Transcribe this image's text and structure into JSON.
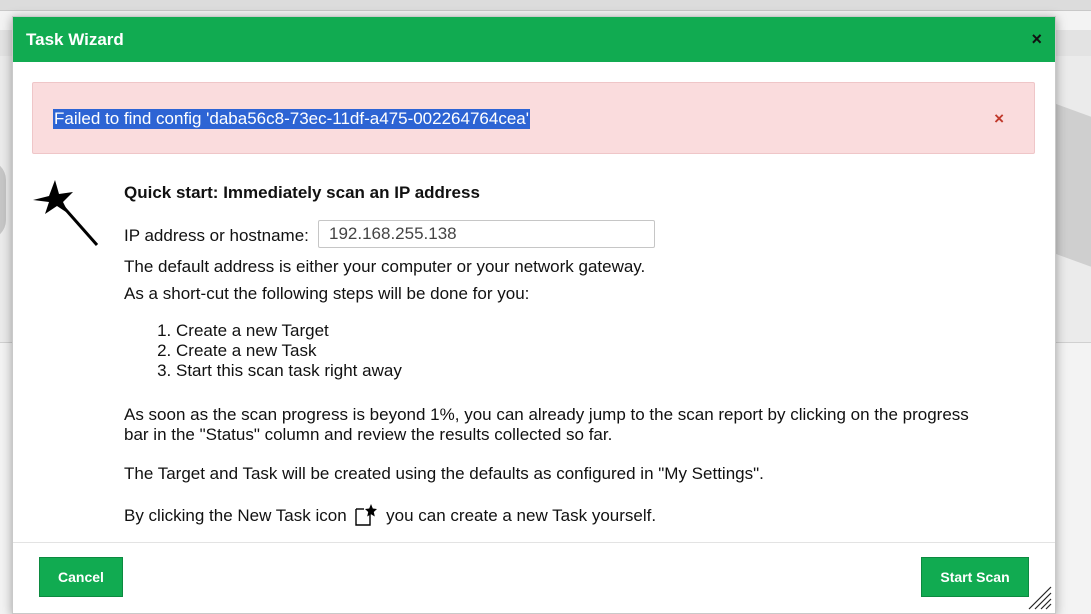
{
  "dialog": {
    "title": "Task Wizard",
    "close_glyph": "×"
  },
  "alert": {
    "message": "Failed to find config 'daba56c8-73ec-11df-a475-002264764cea'",
    "close_glyph": "×"
  },
  "wizard": {
    "heading": "Quick start: Immediately scan an IP address",
    "ip_label": "IP address or hostname:",
    "ip_value": "192.168.255.138",
    "default_note": "The default address is either your computer or your network gateway.",
    "shortcut_note": "As a short-cut the following steps will be done for you:",
    "steps": [
      "Create a new Target",
      "Create a new Task",
      "Start this scan task right away"
    ],
    "progress_note": "As soon as the scan progress is beyond 1%, you can already jump to the scan report by clicking on the progress bar in the \"Status\" column and review the results collected so far.",
    "defaults_note": "The Target and Task will be created using the defaults as configured in \"My Settings\".",
    "new_task_before": "By clicking the New Task icon",
    "new_task_after": "you can create a new Task yourself."
  },
  "footer": {
    "cancel_label": "Cancel",
    "start_label": "Start Scan"
  },
  "icons": {
    "wand": "magic-wand-icon",
    "new_task": "new-task-icon",
    "resize": "resize-handle-icon"
  },
  "colors": {
    "accent": "#11ab51",
    "alert_bg": "#fadcdd",
    "alert_close": "#c0392b",
    "selection": "#2d64d4"
  }
}
